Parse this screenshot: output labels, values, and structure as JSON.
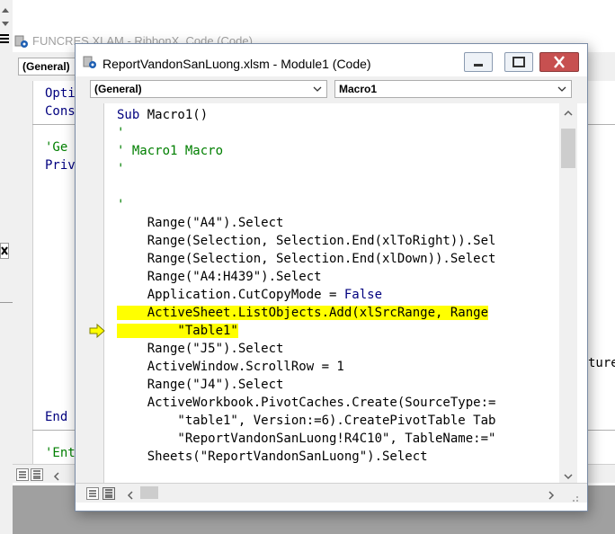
{
  "background_window": {
    "title": "FUNCRES.XLAM - RibbonX_Code (Code)",
    "object_combo": "(General)",
    "code_lines": [
      {
        "kind": "kw",
        "text": "Opti"
      },
      {
        "kind": "kw",
        "text": "Cons"
      },
      {
        "kind": "blank",
        "text": ""
      },
      {
        "kind": "cm",
        "text": "'Ge"
      },
      {
        "kind": "kw",
        "text": "Priv"
      }
    ],
    "end_line": "End",
    "last_line": "'Ent",
    "right_fragment": "ture"
  },
  "window": {
    "title": "ReportVandonSanLuong.xlsm - Module1 (Code)",
    "object_combo": "(General)",
    "procedure_combo": "Macro1"
  },
  "code": [
    {
      "segments": [
        {
          "t": "Sub ",
          "c": "kw"
        },
        {
          "t": "Macro1()",
          "c": "tx"
        }
      ]
    },
    {
      "segments": [
        {
          "t": "'",
          "c": "cm"
        }
      ]
    },
    {
      "segments": [
        {
          "t": "' Macro1 Macro",
          "c": "cm"
        }
      ]
    },
    {
      "segments": [
        {
          "t": "'",
          "c": "cm"
        }
      ]
    },
    {
      "segments": []
    },
    {
      "segments": [
        {
          "t": "'",
          "c": "cm"
        }
      ]
    },
    {
      "segments": [
        {
          "t": "    Range(\"A4\").Select",
          "c": "tx"
        }
      ]
    },
    {
      "segments": [
        {
          "t": "    Range(Selection, Selection.End(xlToRight)).Sel",
          "c": "tx"
        }
      ]
    },
    {
      "segments": [
        {
          "t": "    Range(Selection, Selection.End(xlDown)).Select",
          "c": "tx"
        }
      ]
    },
    {
      "segments": [
        {
          "t": "    Range(\"A4:H439\").Select",
          "c": "tx"
        }
      ]
    },
    {
      "segments": [
        {
          "t": "    Application.CutCopyMode = ",
          "c": "tx"
        },
        {
          "t": "False",
          "c": "kw"
        }
      ]
    },
    {
      "highlight": true,
      "segments": [
        {
          "t": "    ActiveSheet.ListObjects.Add(xlSrcRange, Range",
          "c": "tx"
        }
      ]
    },
    {
      "highlight": true,
      "segments": [
        {
          "t": "        \"Table1\"",
          "c": "tx"
        }
      ]
    },
    {
      "segments": [
        {
          "t": "    Range(\"J5\").Select",
          "c": "tx"
        }
      ]
    },
    {
      "segments": [
        {
          "t": "    ActiveWindow.ScrollRow = 1",
          "c": "tx"
        }
      ]
    },
    {
      "segments": [
        {
          "t": "    Range(\"J4\").Select",
          "c": "tx"
        }
      ]
    },
    {
      "segments": [
        {
          "t": "    ActiveWorkbook.PivotCaches.Create(SourceType:=",
          "c": "tx"
        }
      ]
    },
    {
      "segments": [
        {
          "t": "        \"table1\", Version:=6).CreatePivotTable Tab",
          "c": "tx"
        }
      ]
    },
    {
      "segments": [
        {
          "t": "        \"ReportVandonSanLuong!R4C10\", TableName:=\"",
          "c": "tx"
        }
      ]
    },
    {
      "segments": [
        {
          "t": "    Sheets(\"ReportVandonSanLuong\").Select",
          "c": "tx"
        }
      ]
    }
  ],
  "colors": {
    "keyword": "#00007f",
    "comment": "#007f00",
    "text": "#000000",
    "highlight": "#ffff00",
    "title_bar": "#ffffff"
  }
}
